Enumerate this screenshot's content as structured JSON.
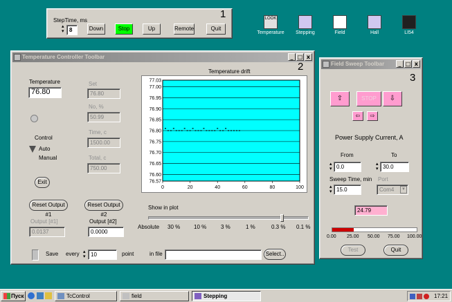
{
  "desktop": {
    "icons": [
      {
        "label": "Temperature",
        "badge": "LOOK"
      },
      {
        "label": "Stepping",
        "badge": ""
      },
      {
        "label": "Field",
        "badge": ""
      },
      {
        "label": "Hall",
        "badge": ""
      },
      {
        "label": "LI54",
        "badge": ""
      }
    ],
    "callouts": [
      "1",
      "2",
      "3"
    ]
  },
  "stepbar": {
    "label": "StepTime, ms",
    "value": "8",
    "buttons": [
      "Down",
      "Stop",
      "Up",
      "Remote",
      "Quit"
    ]
  },
  "temp_window": {
    "title": "Temperature Controller Toolbar",
    "temperature_label": "Temperature",
    "temperature_value": "76.80",
    "set_label": "Set",
    "set_value": "76.80",
    "no_label": "No, %",
    "no_value": "50.99",
    "time_c_label": "Time, c",
    "time_c_value": "1500.00",
    "total_label": "Total, c",
    "total_value": "750.00",
    "control_label": "Control",
    "auto_label": "Auto",
    "manual_label": "Manual",
    "exit_label": "Exit",
    "reset1_label": "Reset Output #1",
    "reset2_label": "Reset Output #2",
    "output1_label": "Output [#1]",
    "output1_value": "0.0137",
    "output2_label": "Output [#2]",
    "output2_value": "0.0000",
    "show_in_plot": "Show in plot",
    "slider_labels": [
      "Absolute",
      "30 %",
      "10 %",
      "3 %",
      "1 %",
      "0.3 %",
      "0.1 %"
    ],
    "slider_value": 0.84,
    "save_label": "Save",
    "every_label": "every",
    "every_value": "10",
    "point_label": "point",
    "infile_label": "in file",
    "infile_value": "",
    "select_label": "Select..",
    "tb_min": "_",
    "tb_max": "□",
    "tb_close": "x"
  },
  "chart_data": {
    "type": "line",
    "title": "Temperature drift",
    "bg": "#00ffff",
    "xlim": [
      0,
      100
    ],
    "ylim": [
      76.57,
      77.03
    ],
    "xticks": [
      0,
      20,
      40,
      60,
      80,
      100
    ],
    "yticks": [
      77.03,
      77.0,
      76.95,
      76.9,
      76.85,
      76.8,
      76.75,
      76.7,
      76.65,
      76.6,
      76.57
    ],
    "ytick_labels": [
      "77.03",
      "77.00",
      "76.95",
      "76.90",
      "76.85",
      "76.80",
      "76.75",
      "76.70",
      "76.65",
      "76.60",
      "76.57"
    ],
    "series": [
      {
        "values": [
          [
            2,
            76.81
          ],
          [
            4,
            76.8
          ],
          [
            6,
            76.8
          ],
          [
            8,
            76.81
          ],
          [
            10,
            76.8
          ],
          [
            12,
            76.8
          ],
          [
            14,
            76.8
          ],
          [
            16,
            76.81
          ],
          [
            18,
            76.8
          ],
          [
            20,
            76.8
          ],
          [
            22,
            76.81
          ],
          [
            24,
            76.8
          ],
          [
            26,
            76.8
          ],
          [
            28,
            76.8
          ],
          [
            30,
            76.81
          ],
          [
            32,
            76.8
          ],
          [
            34,
            76.8
          ],
          [
            36,
            76.8
          ],
          [
            38,
            76.8
          ],
          [
            40,
            76.81
          ],
          [
            42,
            76.8
          ],
          [
            44,
            76.8
          ],
          [
            46,
            76.81
          ],
          [
            48,
            76.8
          ],
          [
            50,
            76.8
          ],
          [
            52,
            76.8
          ],
          [
            54,
            76.8
          ],
          [
            56,
            76.8
          ]
        ]
      }
    ]
  },
  "field_window": {
    "title": "Field Sweep Toolbar",
    "stop_label": "STOP",
    "psc_label": "Power Supply Current, A",
    "from_label": "From",
    "from_value": "0.0",
    "to_label": "To",
    "to_value": "30.0",
    "sweep_label": "Sweep Time, min",
    "sweep_value": "15.0",
    "port_label": "Port",
    "port_value": "Com4",
    "current_value": "24.79",
    "progress": 0.25,
    "progress_labels": [
      "0.00",
      "25.00",
      "50.00",
      "75.00",
      "100.00"
    ],
    "test_label": "Test",
    "quit_label": "Quit",
    "tb_min": "_",
    "tb_max": "□",
    "tb_close": "x"
  },
  "taskbar": {
    "start": "Пуск",
    "tasks": [
      "TcControl",
      "field",
      "Stepping"
    ],
    "clock": "17:21"
  }
}
